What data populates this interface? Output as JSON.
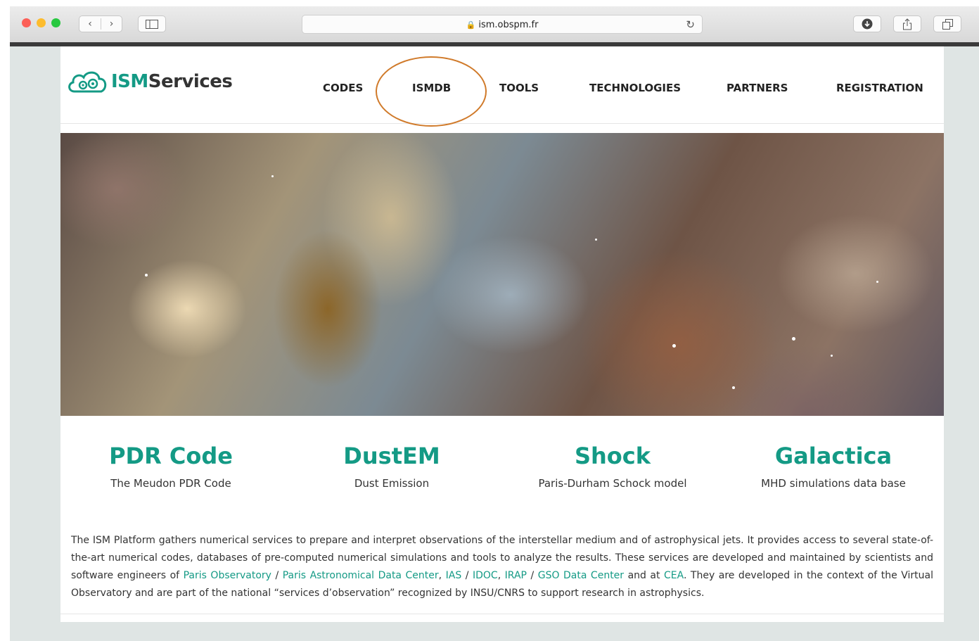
{
  "browser": {
    "url": "ism.obspm.fr",
    "back_icon": "chevron-left-icon",
    "forward_icon": "chevron-right-icon"
  },
  "site": {
    "logo_ism": "ISM",
    "logo_services": "Services",
    "nav": [
      "CODES",
      "ISMDB",
      "TOOLS",
      "TECHNOLOGIES",
      "PARTNERS",
      "REGISTRATION"
    ],
    "highlighted_nav": "ISMDB",
    "accent_color": "#149a85",
    "annotation_color": "#d07a2a"
  },
  "services": [
    {
      "title": "PDR Code",
      "subtitle": "The Meudon PDR Code"
    },
    {
      "title": "DustEM",
      "subtitle": "Dust Emission"
    },
    {
      "title": "Shock",
      "subtitle": "Paris-Durham Schock model"
    },
    {
      "title": "Galactica",
      "subtitle": "MHD simulations data base"
    }
  ],
  "description": {
    "p1": "The ISM Platform gathers numerical services to prepare and interpret observations of the interstellar medium and of astrophysical jets. It provides access to several state-of-the-art numerical codes, databases of pre-computed numerical simulations and tools to analyze the results. These services are developed and maintained by scientists and software engineers of ",
    "link1": "Paris Observatory",
    "sep1": " / ",
    "link2": "Paris Astronomical Data Center",
    "sep2": ", ",
    "link3": "IAS",
    "sep3": " / ",
    "link4": "IDOC",
    "sep4": ", ",
    "link5": "IRAP",
    "sep5": " / ",
    "link6": "GSO Data Center",
    "sep6": " and at ",
    "link7": "CEA",
    "p2": ". They are developed in the context of the Virtual Observatory and are part of the national “services d’observation” recognized by INSU/CNRS to support research in astrophysics."
  }
}
